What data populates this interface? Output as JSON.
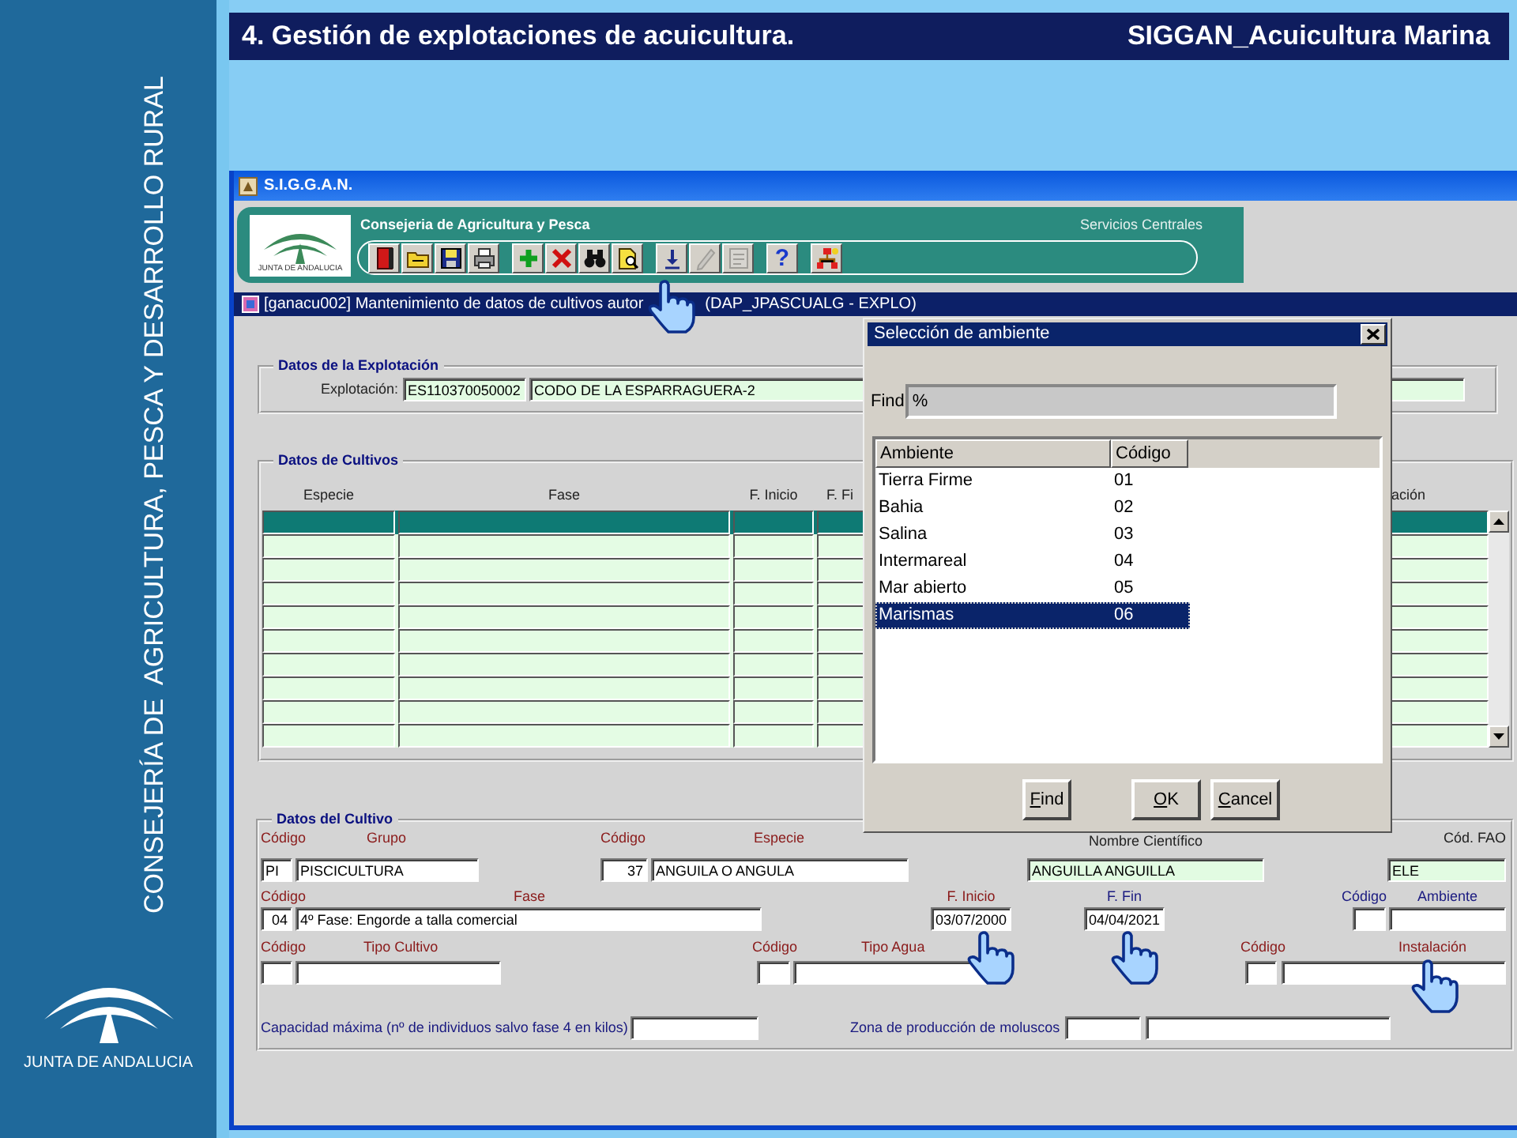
{
  "slide": {
    "title": "4. Gestión de explotaciones de acuicultura.",
    "app": "SIGGAN_Acuicultura Marina",
    "side_text": "CONSEJERÍA DE  AGRICULTURA, PESCA Y DESARROLLO RURAL",
    "side_logo_text": "JUNTA DE ANDALUCIA"
  },
  "window": {
    "title": "S.I.G.G.A.N."
  },
  "banner": {
    "logo_text": "JUNTA DE ANDALUCIA",
    "org": "Consejeria de Agricultura y Pesca",
    "office": "Servicios Centrales"
  },
  "toolbar": [
    {
      "buttons": [
        {
          "kind": "exit",
          "disabled": false
        },
        {
          "kind": "folder",
          "disabled": false
        },
        {
          "kind": "save",
          "disabled": false
        },
        {
          "kind": "print",
          "disabled": false
        }
      ]
    },
    {
      "buttons": [
        {
          "kind": "add",
          "disabled": false
        },
        {
          "kind": "delete",
          "disabled": false
        },
        {
          "kind": "find",
          "disabled": false
        },
        {
          "kind": "preview",
          "disabled": false
        }
      ]
    },
    {
      "buttons": [
        {
          "kind": "download",
          "disabled": false
        },
        {
          "kind": "edit",
          "disabled": true
        },
        {
          "kind": "sheet",
          "disabled": true
        }
      ]
    },
    {
      "buttons": [
        {
          "kind": "help",
          "glyph": "?",
          "disabled": false
        }
      ]
    },
    {
      "buttons": [
        {
          "kind": "hierarchy",
          "disabled": false
        }
      ]
    }
  ],
  "form": {
    "title": "[ganacu002] Mantenimiento de datos de cultivos autor",
    "user": "(DAP_JPASCUALG - EXPLO)"
  },
  "explotacion": {
    "legend": "Datos de la Explotación",
    "label": "Explotación:",
    "code": "ES110370050002",
    "name": "CODO DE LA ESPARRAGUERA-2"
  },
  "cultivos": {
    "legend": "Datos de Cultivos",
    "columns": [
      "Especie",
      "Fase",
      "F. Inicio",
      "F. Fi",
      "ación"
    ],
    "rows": [
      {
        "selected": true
      },
      {
        "selected": false
      },
      {
        "selected": false
      },
      {
        "selected": false
      },
      {
        "selected": false
      },
      {
        "selected": false
      },
      {
        "selected": false
      },
      {
        "selected": false
      },
      {
        "selected": false
      },
      {
        "selected": false
      }
    ]
  },
  "cultivo": {
    "legend": "Datos del Cultivo",
    "grupo": {
      "code_label": "Código",
      "label": "Grupo",
      "code": "PI",
      "value": "PISCICULTURA"
    },
    "especie": {
      "code_label": "Código",
      "label": "Especie",
      "code": "37",
      "value": "ANGUILA O ANGULA"
    },
    "nombre_cientifico": {
      "label": "Nombre Científico",
      "value": "ANGUILLA ANGUILLA"
    },
    "cod_fao": {
      "label": "Cód. FAO",
      "value": "ELE"
    },
    "fase": {
      "code_label": "Código",
      "label": "Fase",
      "code": "04",
      "value": "4º Fase: Engorde a talla comercial"
    },
    "f_inicio": {
      "label": "F. Inicio",
      "value": "03/07/2000"
    },
    "f_fin": {
      "label": "F. Fin",
      "value": "04/04/2021"
    },
    "ambiente": {
      "code_label": "Código",
      "label": "Ambiente"
    },
    "tipo_cultivo": {
      "code_label": "Código",
      "label": "Tipo Cultivo"
    },
    "tipo_agua": {
      "code_label": "Código",
      "label": "Tipo Agua"
    },
    "instalacion": {
      "code_label": "Código",
      "label": "Instalación"
    },
    "capacidad": {
      "label": "Capacidad máxima (nº de individuos salvo fase 4 en kilos)"
    },
    "zona": {
      "label": "Zona de producción de moluscos"
    }
  },
  "dialog": {
    "title": "Selección de ambiente",
    "find_label": "Find",
    "find_value": "%",
    "columns": [
      "Ambiente",
      "Código"
    ],
    "rows": [
      {
        "ambiente": "Tierra Firme",
        "codigo": "01",
        "selected": false
      },
      {
        "ambiente": "Bahia",
        "codigo": "02",
        "selected": false
      },
      {
        "ambiente": "Salina",
        "codigo": "03",
        "selected": false
      },
      {
        "ambiente": "Intermareal",
        "codigo": "04",
        "selected": false
      },
      {
        "ambiente": "Mar abierto",
        "codigo": "05",
        "selected": false
      },
      {
        "ambiente": "Marismas",
        "codigo": "06",
        "selected": true
      }
    ],
    "buttons": [
      {
        "label": "Find"
      },
      {
        "label": "OK"
      },
      {
        "label": "Cancel"
      }
    ]
  }
}
